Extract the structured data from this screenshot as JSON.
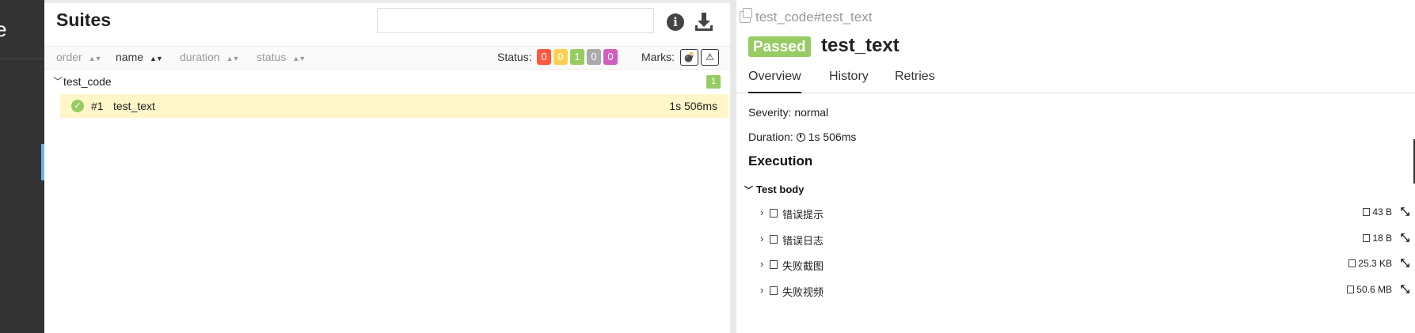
{
  "sidebar": {
    "brand_fragment": "e"
  },
  "suites": {
    "title": "Suites",
    "search_placeholder": "",
    "columns": [
      {
        "label": "order",
        "sort_icon": "sort-both"
      },
      {
        "label": "name",
        "sort_icon": "sort-asc"
      },
      {
        "label": "duration",
        "sort_icon": "sort-both"
      },
      {
        "label": "status",
        "sort_icon": "sort-both"
      }
    ],
    "status_label": "Status:",
    "status_counts": [
      {
        "name": "failed",
        "value": "0",
        "color": "#fd5a3e"
      },
      {
        "name": "broken",
        "value": "0",
        "color": "#ffd050"
      },
      {
        "name": "passed",
        "value": "1",
        "color": "#97cc64"
      },
      {
        "name": "skipped",
        "value": "0",
        "color": "#aaaaaa"
      },
      {
        "name": "unknown",
        "value": "0",
        "color": "#d35ebe"
      }
    ],
    "marks_label": "Marks:",
    "marks": [
      "flaky-icon",
      "warning-icon"
    ],
    "group": {
      "name": "test_code",
      "count": "1"
    },
    "test": {
      "status_icon": "check-circle-icon",
      "number": "#1",
      "name": "test_text",
      "duration": "1s 506ms"
    }
  },
  "detail": {
    "breadcrumb": "test_code#test_text",
    "status": "Passed",
    "title": "test_text",
    "tabs": [
      "Overview",
      "History",
      "Retries"
    ],
    "severity": "Severity: normal",
    "duration_label": "Duration:",
    "duration_value": "1s 506ms",
    "execution_title": "Execution",
    "step_title": "Test body",
    "attachments": [
      {
        "name": "错误提示",
        "size": "43 B",
        "icon": "text-file-icon"
      },
      {
        "name": "错误日志",
        "size": "18 B",
        "icon": "text-file-icon"
      },
      {
        "name": "失败截图",
        "size": "25.3 KB",
        "icon": "image-file-icon"
      },
      {
        "name": "失败视频",
        "size": "50.6 MB",
        "icon": "video-file-icon"
      }
    ]
  },
  "colors": {
    "passed": "#97cc64",
    "sidebar": "#333333",
    "selected_row": "#fff6c9"
  }
}
